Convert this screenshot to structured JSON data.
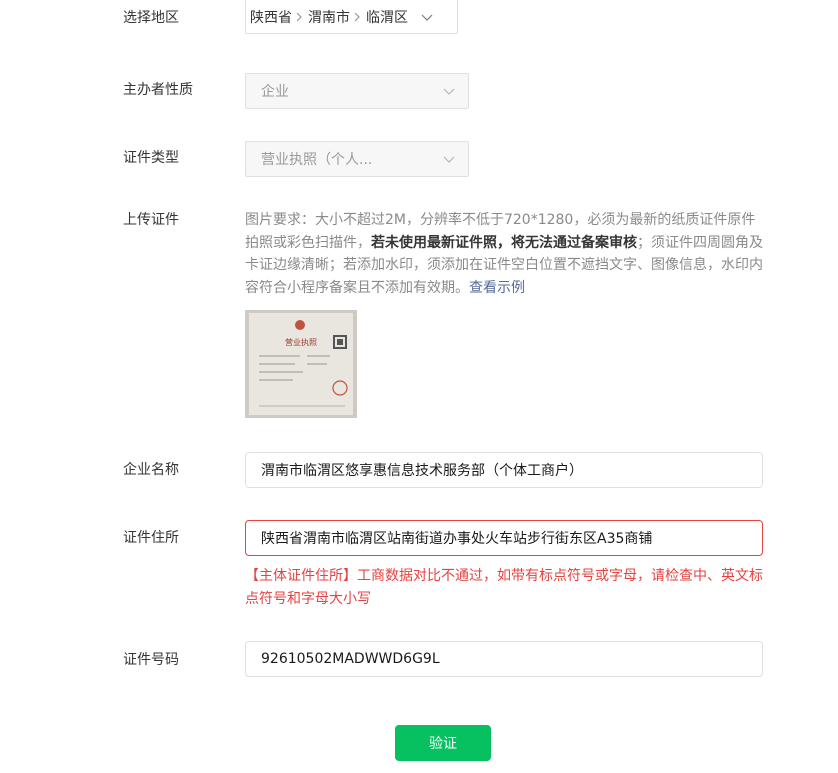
{
  "region": {
    "label": "选择地区",
    "province": "陕西省",
    "city": "渭南市",
    "district": "临渭区"
  },
  "subject_nature": {
    "label": "主办者性质",
    "value": "企业"
  },
  "cert_type": {
    "label": "证件类型",
    "value": "营业执照（个人..."
  },
  "upload": {
    "label": "上传证件",
    "desc_part1": "图片要求：大小不超过2M，分辨率不低于720*1280，必须为最新的纸质证件原件拍照或彩色扫描件，",
    "desc_bold": "若未使用最新证件照，将无法通过备案审核",
    "desc_part2": "；须证件四周圆角及卡证边缘清晰；若添加水印，须添加在证件空白位置不遮挡文字、图像信息，水印内容符合小程序备案且不添加有效期。",
    "example_link": "查看示例",
    "thumbnail_title": "营业执照"
  },
  "company_name": {
    "label": "企业名称",
    "value": "渭南市临渭区悠享惠信息技术服务部（个体工商户）"
  },
  "cert_address": {
    "label": "证件住所",
    "value": "陕西省渭南市临渭区站南街道办事处火车站步行街东区A35商铺",
    "error": "【主体证件住所】工商数据对比不通过，如带有标点符号或字母，请检查中、英文标点符号和字母大小写"
  },
  "cert_number": {
    "label": "证件号码",
    "value": "92610502MADWWD6G9L"
  },
  "verify_button": "验证",
  "colors": {
    "primary_green": "#07c160",
    "error_red": "#e64340",
    "link_blue": "#576b95"
  }
}
